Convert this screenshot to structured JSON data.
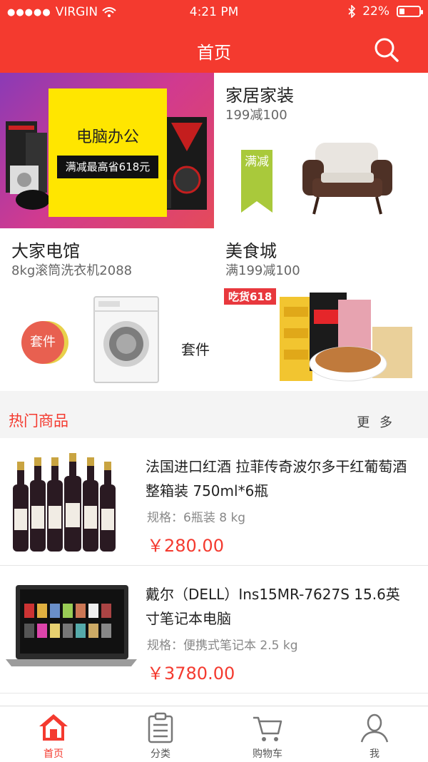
{
  "status": {
    "carrier": "VIRGIN",
    "time": "4:21 PM",
    "battery": "22%"
  },
  "nav": {
    "title": "首页",
    "search_icon": "search-icon"
  },
  "promos": [
    {
      "title": "电脑办公",
      "subtitle": "满减最高省618元"
    },
    {
      "title": "家居家装",
      "subtitle": "199减100",
      "ribbon": "满减"
    },
    {
      "title": "大家电馆",
      "subtitle": "8kg滚筒洗衣机2088",
      "badge": "套件",
      "label": "套件"
    },
    {
      "title": "美食城",
      "subtitle": "满199减100",
      "tag": "吃货618"
    }
  ],
  "hot": {
    "title": "热门商品",
    "more": "更 多"
  },
  "products": [
    {
      "name": "法国进口红酒 拉菲传奇波尔多干红葡萄酒 整箱装 750ml*6瓶",
      "spec": "规格：6瓶装 8 kg",
      "price": "￥280.00"
    },
    {
      "name": "戴尔（DELL）Ins15MR-7627S 15.6英寸笔记本电脑",
      "spec": "规格：便携式笔记本 2.5 kg",
      "price": "￥3780.00"
    }
  ],
  "tabs": [
    {
      "label": "首页",
      "icon": "home-icon",
      "active": true
    },
    {
      "label": "分类",
      "icon": "category-list-icon"
    },
    {
      "label": "购物车",
      "icon": "cart-icon"
    },
    {
      "label": "我",
      "icon": "user-icon"
    }
  ],
  "colors": {
    "brand_red": "#f43a2f",
    "price_red": "#f43a2f",
    "yellow": "#ffe600"
  }
}
